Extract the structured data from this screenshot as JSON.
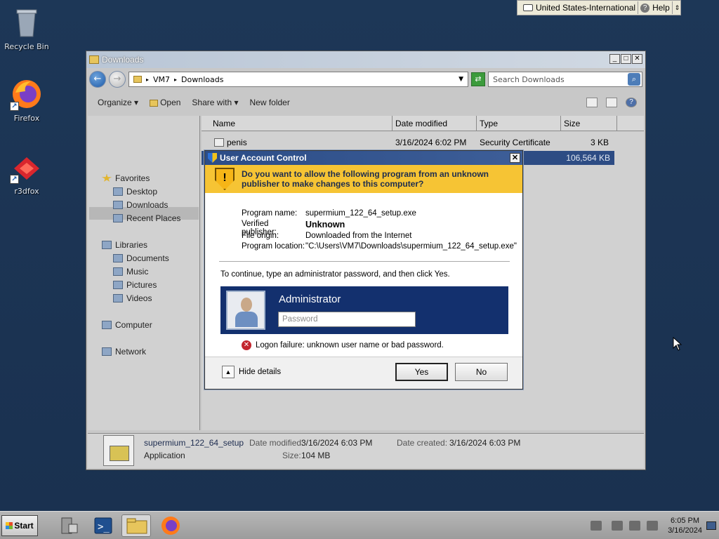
{
  "desktop": {
    "icons": [
      {
        "label": "Recycle Bin",
        "icon": "recycle-bin-icon"
      },
      {
        "label": "Firefox",
        "icon": "firefox-icon"
      },
      {
        "label": "r3dfox",
        "icon": "r3dfox-icon"
      }
    ]
  },
  "langbar": {
    "language": "United States-International",
    "help": "Help"
  },
  "explorer": {
    "title": "Downloads",
    "address": {
      "root": "VM7",
      "folder": "Downloads"
    },
    "search_placeholder": "Search Downloads",
    "toolbar": {
      "organize": "Organize",
      "open": "Open",
      "share_with": "Share with",
      "new_folder": "New folder"
    },
    "nav": {
      "favorites": "Favorites",
      "desktop": "Desktop",
      "downloads": "Downloads",
      "recent_places": "Recent Places",
      "libraries": "Libraries",
      "documents": "Documents",
      "music": "Music",
      "pictures": "Pictures",
      "videos": "Videos",
      "computer": "Computer",
      "network": "Network"
    },
    "columns": {
      "name": "Name",
      "date": "Date modified",
      "type": "Type",
      "size": "Size"
    },
    "files": [
      {
        "name": "penis",
        "date": "3/16/2024 6:02 PM",
        "type": "Security Certificate",
        "size": "3 KB"
      },
      {
        "name": "",
        "date": "",
        "type": "",
        "size": "106,564 KB"
      }
    ],
    "details": {
      "name": "supermium_122_64_setup",
      "kind": "Application",
      "date_modified_label": "Date modified:",
      "date_modified": "3/16/2024 6:03 PM",
      "size_label": "Size:",
      "size": "104 MB",
      "date_created_label": "Date created:",
      "date_created": "3/16/2024 6:03 PM"
    }
  },
  "uac": {
    "title": "User Account Control",
    "question": "Do you want to allow the following program from an unknown publisher to make changes to this computer?",
    "program_name_label": "Program name:",
    "program_name": "supermium_122_64_setup.exe",
    "publisher_label": "Verified publisher:",
    "publisher": "Unknown",
    "origin_label": "File origin:",
    "origin": "Downloaded from the Internet",
    "location_label": "Program location:",
    "location": "\"C:\\Users\\VM7\\Downloads\\supermium_122_64_setup.exe\"",
    "instruction": "To continue, type an administrator password, and then click Yes.",
    "account": "Administrator",
    "password_placeholder": "Password",
    "error": "Logon failure: unknown user name or bad password.",
    "hide_details": "Hide details",
    "yes": "Yes",
    "no": "No"
  },
  "taskbar": {
    "start": "Start",
    "time": "6:05 PM",
    "date": "3/16/2024"
  }
}
